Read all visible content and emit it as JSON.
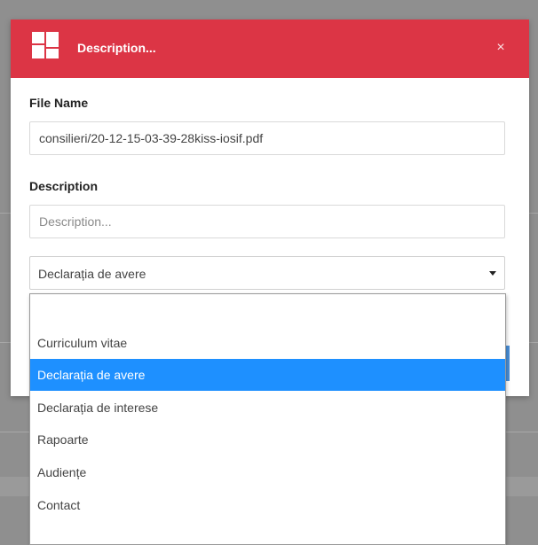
{
  "modal": {
    "title": "Description...",
    "close_label": "×"
  },
  "file_name": {
    "label": "File Name",
    "value": "consilieri/20-12-15-03-39-28kiss-iosif.pdf"
  },
  "description": {
    "label": "Description",
    "placeholder": "Description..."
  },
  "category_select": {
    "selected": "Declarația de avere",
    "options": [
      "",
      "Curriculum vitae",
      "Declarația de avere",
      "Declarația de interese",
      "Rapoarte",
      "Audiențe",
      "Contact"
    ],
    "highlighted_index": 2
  },
  "colors": {
    "header": "#dc3545",
    "highlight": "#1e90ff",
    "overlay": "#8f8f8f"
  }
}
